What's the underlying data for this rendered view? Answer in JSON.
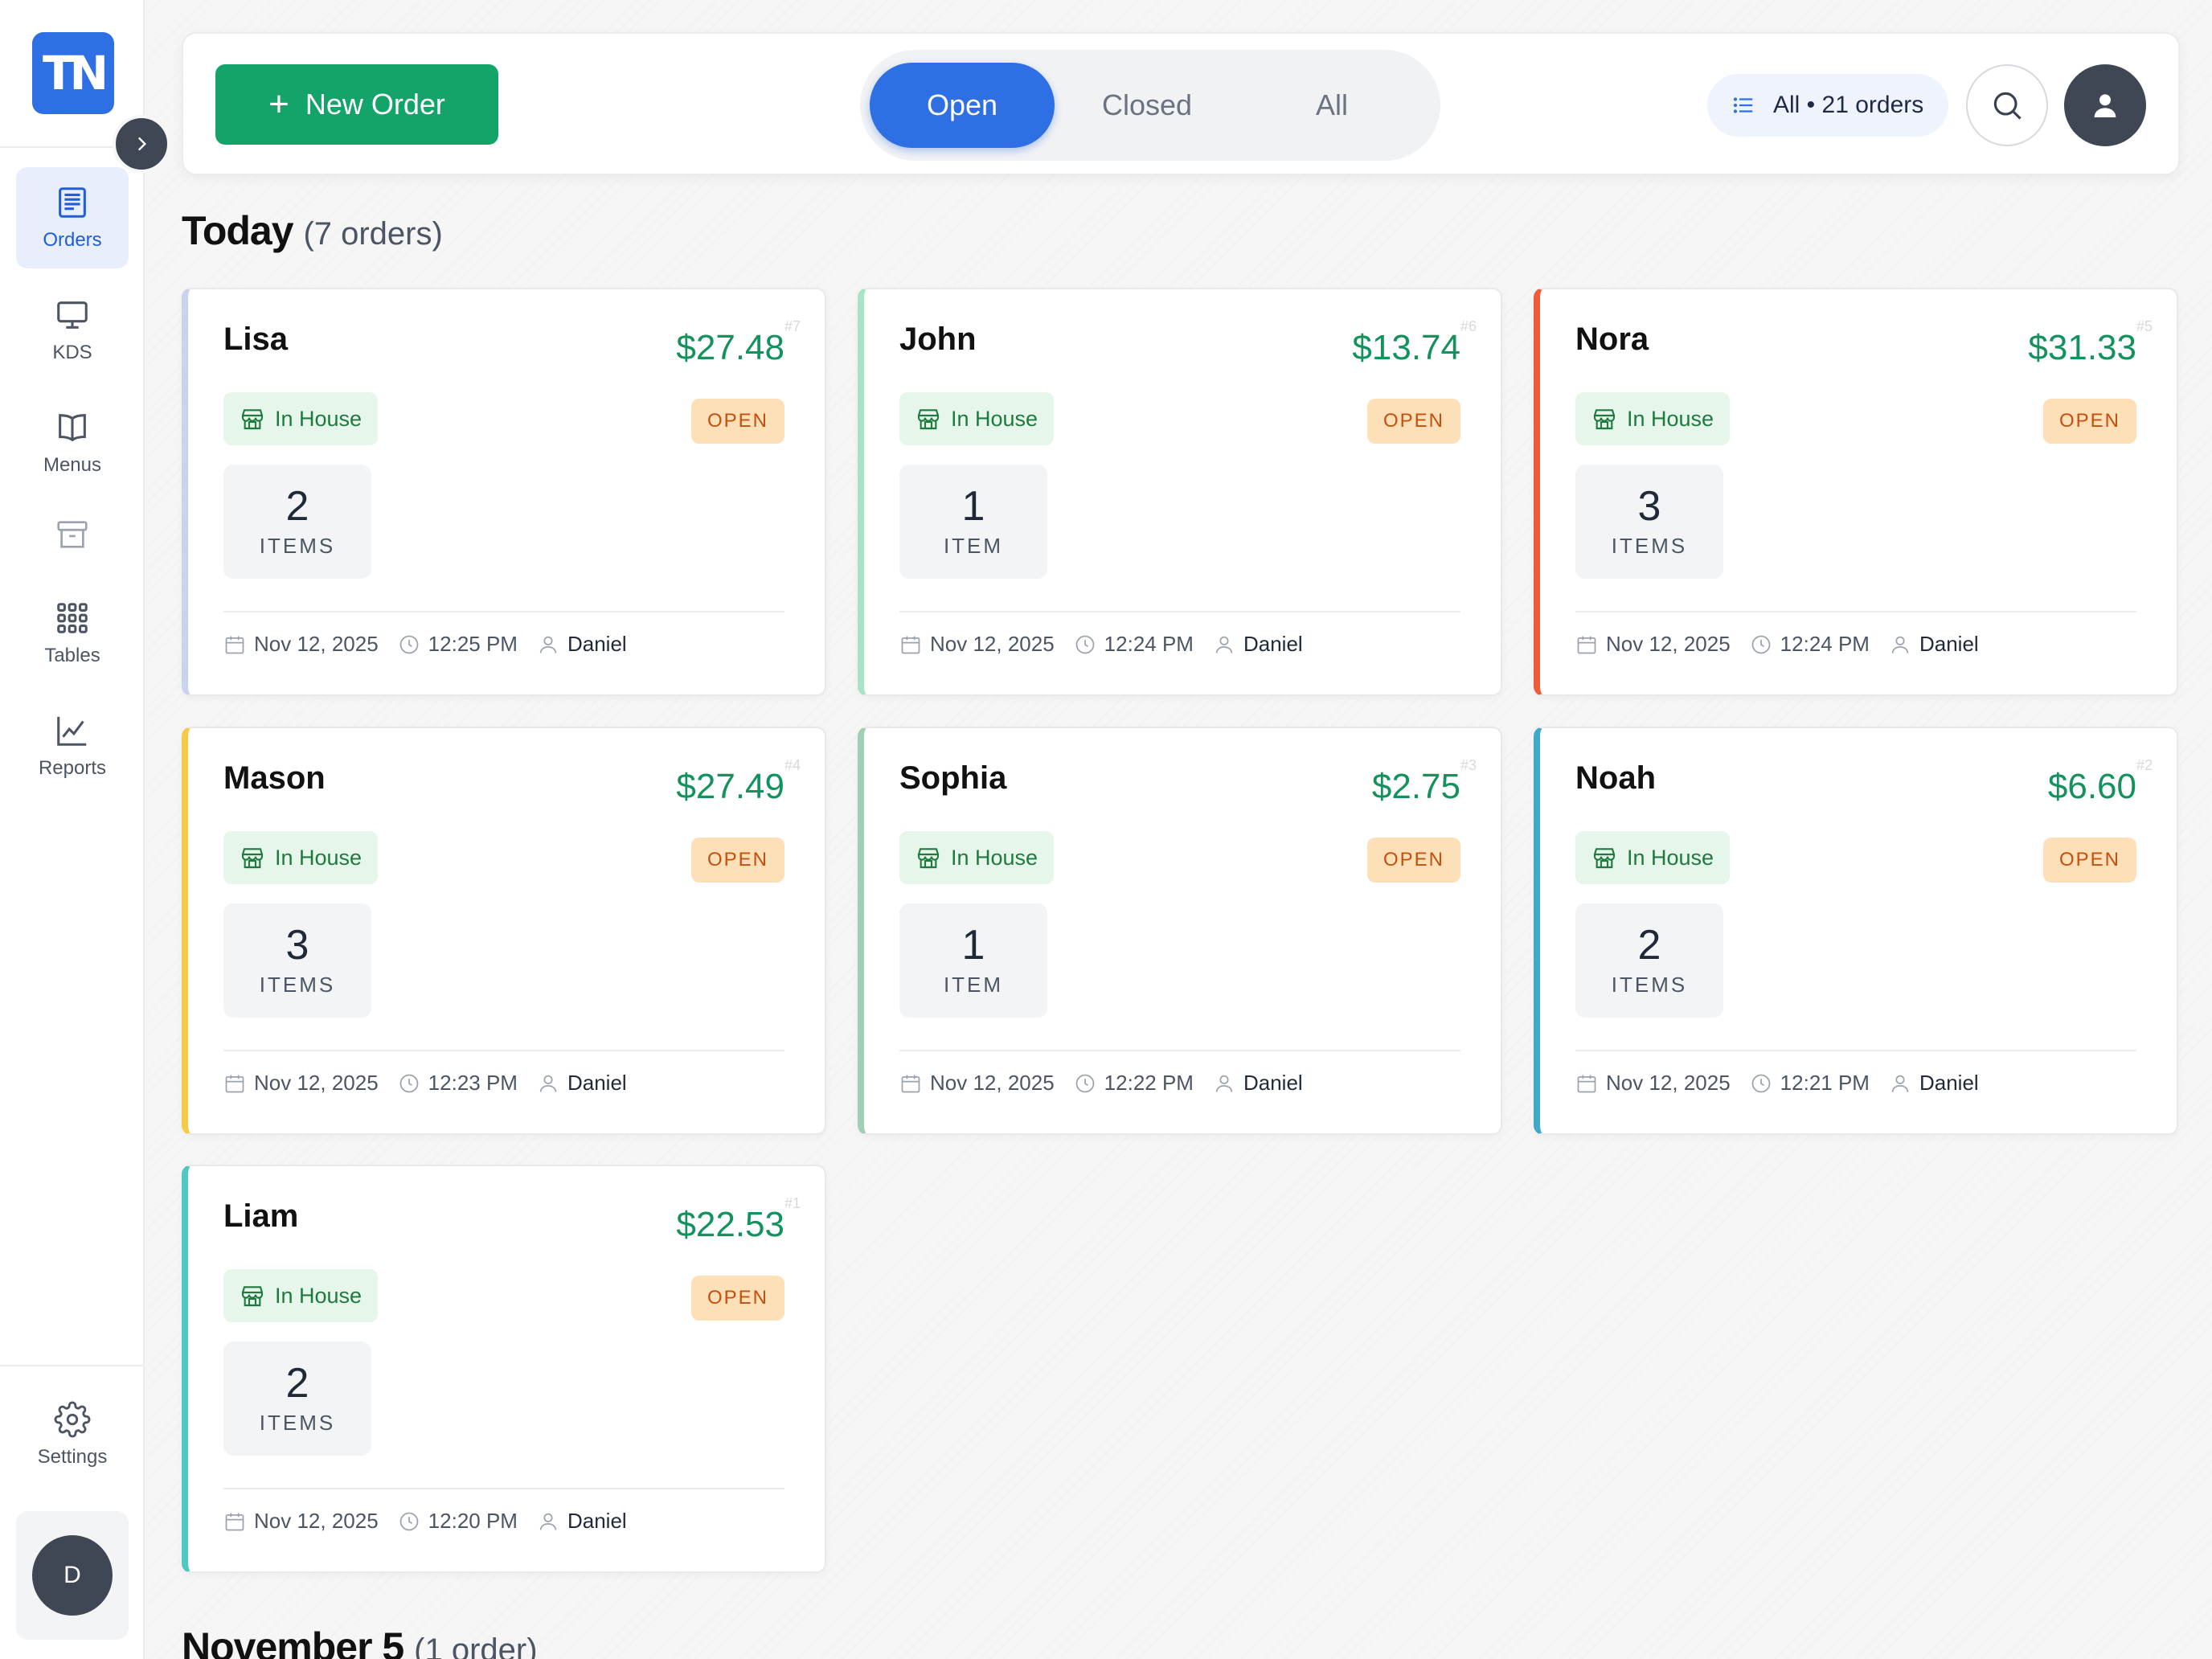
{
  "sidebar": {
    "logo_text": "TN",
    "nav": [
      {
        "label": "Orders",
        "icon": "receipt-icon",
        "active": true
      },
      {
        "label": "KDS",
        "icon": "monitor-icon"
      },
      {
        "label": "Menus",
        "icon": "book-icon"
      },
      {
        "label": "",
        "icon": "archive-icon"
      },
      {
        "label": "Tables",
        "icon": "grid-icon"
      },
      {
        "label": "Reports",
        "icon": "line-chart-icon"
      }
    ],
    "settings_label": "Settings",
    "user_initial": "D"
  },
  "toolbar": {
    "new_order_label": "New Order",
    "tabs": [
      {
        "label": "Open",
        "active": true
      },
      {
        "label": "Closed",
        "active": false
      },
      {
        "label": "All",
        "active": false
      }
    ],
    "filter_label": "All • 21 orders"
  },
  "sections": [
    {
      "title": "Today",
      "count": "(7 orders)"
    },
    {
      "title": "November 5",
      "count": "(1 order)"
    }
  ],
  "orders": [
    {
      "name": "Lisa",
      "total": "$27.48",
      "num": "#7",
      "type": "In House",
      "status": "OPEN",
      "items_count": "2",
      "items_label": "ITEMS",
      "date": "Nov 12, 2025",
      "time": "12:25 PM",
      "staff": "Daniel",
      "accent": "#c9d3ee"
    },
    {
      "name": "John",
      "total": "$13.74",
      "num": "#6",
      "type": "In House",
      "status": "OPEN",
      "items_count": "1",
      "items_label": "ITEM",
      "date": "Nov 12, 2025",
      "time": "12:24 PM",
      "staff": "Daniel",
      "accent": "#a7e3c6"
    },
    {
      "name": "Nora",
      "total": "$31.33",
      "num": "#5",
      "type": "In House",
      "status": "OPEN",
      "items_count": "3",
      "items_label": "ITEMS",
      "date": "Nov 12, 2025",
      "time": "12:24 PM",
      "staff": "Daniel",
      "accent": "#ef5a3c"
    },
    {
      "name": "Mason",
      "total": "$27.49",
      "num": "#4",
      "type": "In House",
      "status": "OPEN",
      "items_count": "3",
      "items_label": "ITEMS",
      "date": "Nov 12, 2025",
      "time": "12:23 PM",
      "staff": "Daniel",
      "accent": "#f7c948"
    },
    {
      "name": "Sophia",
      "total": "$2.75",
      "num": "#3",
      "type": "In House",
      "status": "OPEN",
      "items_count": "1",
      "items_label": "ITEM",
      "date": "Nov 12, 2025",
      "time": "12:22 PM",
      "staff": "Daniel",
      "accent": "#9fd0b4"
    },
    {
      "name": "Noah",
      "total": "$6.60",
      "num": "#2",
      "type": "In House",
      "status": "OPEN",
      "items_count": "2",
      "items_label": "ITEMS",
      "date": "Nov 12, 2025",
      "time": "12:21 PM",
      "staff": "Daniel",
      "accent": "#3fa9c9"
    },
    {
      "name": "Liam",
      "total": "$22.53",
      "num": "#1",
      "type": "In House",
      "status": "OPEN",
      "items_count": "2",
      "items_label": "ITEMS",
      "date": "Nov 12, 2025",
      "time": "12:20 PM",
      "staff": "Daniel",
      "accent": "#4fc8c0"
    }
  ],
  "colors": {
    "primary": "#2f6fe4",
    "new_order_green": "#14a46a",
    "total_green": "#14925d",
    "open_badge_bg": "#fddfb8",
    "open_badge_text": "#c2500f",
    "in_house_bg": "#e7f6ea",
    "in_house_text": "#1e7a3e"
  }
}
